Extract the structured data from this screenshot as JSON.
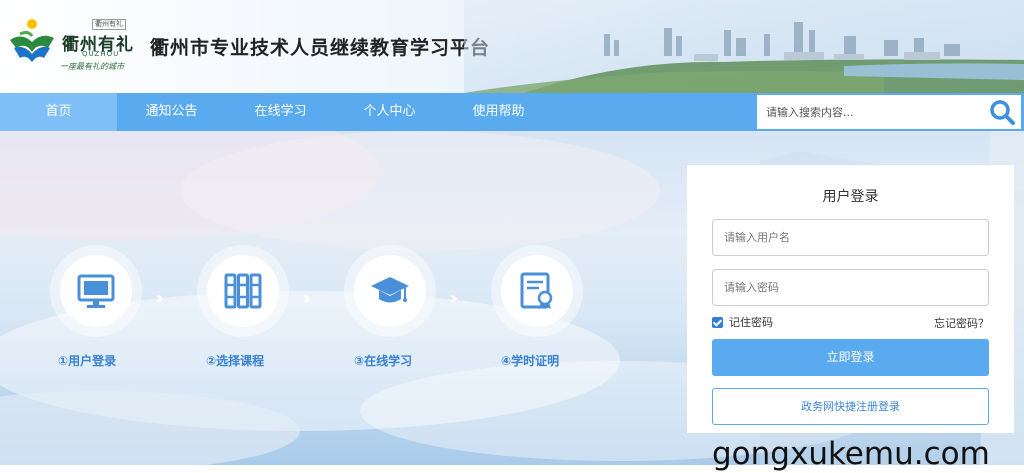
{
  "header": {
    "logo_seal": "衢州有礼",
    "logo_name": "衢州有礼",
    "logo_pinyin": "QUZHOU",
    "logo_slogan": "一座最有礼的城市",
    "site_title": "衢州市专业技术人员继续教育学习平台"
  },
  "nav": {
    "items": [
      {
        "label": "首页",
        "active": true
      },
      {
        "label": "通知公告",
        "active": false
      },
      {
        "label": "在线学习",
        "active": false
      },
      {
        "label": "个人中心",
        "active": false
      },
      {
        "label": "使用帮助",
        "active": false
      }
    ],
    "search_placeholder": "请输入搜索内容..."
  },
  "steps": [
    {
      "label": "①用户登录",
      "icon": "monitor-icon"
    },
    {
      "label": "②选择课程",
      "icon": "books-icon"
    },
    {
      "label": "③在线学习",
      "icon": "graduation-cap-icon"
    },
    {
      "label": "④学时证明",
      "icon": "certificate-icon"
    }
  ],
  "login": {
    "title": "用户登录",
    "username_placeholder": "请输入用户名",
    "password_placeholder": "请输入密码",
    "remember_label": "记住密码",
    "remember_checked": true,
    "forgot_label": "忘记密码？",
    "submit_label": "立即登录",
    "gov_login_label": "政务网快捷注册登录"
  },
  "watermark": "gongxukemu.com",
  "colors": {
    "nav_bg": "#5aaaf0",
    "nav_active": "#7fbef6",
    "step_label": "#3a82d2",
    "primary_button": "#5aaaf0",
    "search_icon": "#3d8fe0"
  }
}
